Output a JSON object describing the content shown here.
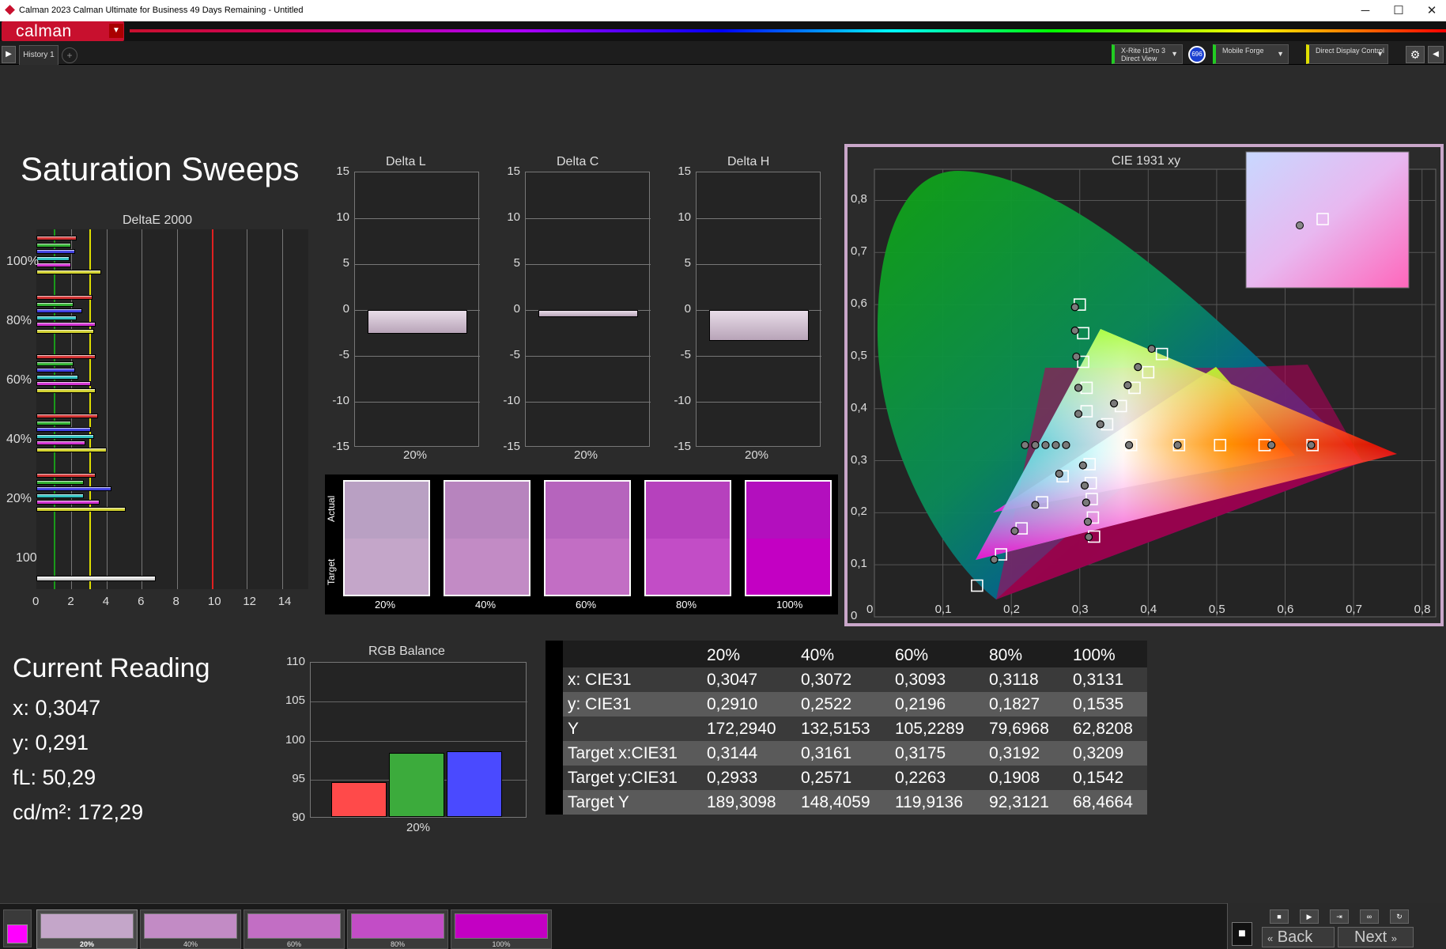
{
  "window": {
    "title": "Calman 2023 Calman Ultimate for Business 49 Days Remaining  - Untitled",
    "min": "─",
    "max": "☐",
    "close": "✕"
  },
  "app": {
    "logo": "calman",
    "history_tab": "History 1",
    "add_tab": "+"
  },
  "devices": [
    {
      "label1": "X-Rite i1Pro 3",
      "label2": "Direct View",
      "color": "#22cc22"
    },
    {
      "badge": "696"
    },
    {
      "label1": "Mobile Forge",
      "label2": "",
      "color": "#22cc22"
    },
    {
      "label1": "Direct Display Control",
      "label2": "",
      "color": "#e0e000"
    }
  ],
  "page": {
    "title": "Saturation Sweeps"
  },
  "deltae": {
    "title": "DeltaE 2000",
    "x_ticks": [
      "0",
      "2",
      "4",
      "6",
      "8",
      "10",
      "12",
      "14"
    ],
    "row_labels": [
      "100%",
      "80%",
      "60%",
      "40%",
      "20%",
      "100"
    ]
  },
  "delta_charts": [
    {
      "title": "Delta L",
      "value": -2.6,
      "xlabel": "20%"
    },
    {
      "title": "Delta C",
      "value": -0.8,
      "xlabel": "20%"
    },
    {
      "title": "Delta H",
      "value": -3.4,
      "xlabel": "20%"
    }
  ],
  "delta_ticks": [
    "15",
    "10",
    "5",
    "0",
    "-5",
    "-10",
    "-15"
  ],
  "swatches": {
    "actual_label": "Actual",
    "target_label": "Target",
    "items": [
      {
        "label": "20%",
        "actual": "#b9a0c3",
        "target": "#c4a6c9"
      },
      {
        "label": "40%",
        "actual": "#b784be",
        "target": "#c28bc5"
      },
      {
        "label": "60%",
        "actual": "#b664bd",
        "target": "#c26ec4"
      },
      {
        "label": "80%",
        "actual": "#b641bd",
        "target": "#c24dc6"
      },
      {
        "label": "100%",
        "actual": "#b30fbe",
        "target": "#c300c3"
      }
    ]
  },
  "cie": {
    "title": "CIE 1931 xy",
    "x_ticks": [
      "0",
      "0,1",
      "0,2",
      "0,3",
      "0,4",
      "0,5",
      "0,6",
      "0,7",
      "0,8"
    ],
    "y_ticks": [
      "0,8",
      "0,7",
      "0,6",
      "0,5",
      "0,4",
      "0,3",
      "0,2",
      "0,1",
      "0"
    ]
  },
  "reading": {
    "title": "Current Reading",
    "x": "x: 0,3047",
    "y": "y: 0,291",
    "fl": "fL: 50,29",
    "cd": "cd/m²: 172,29"
  },
  "rgb": {
    "title": "RGB Balance",
    "y_ticks": [
      "110",
      "105",
      "100",
      "95",
      "90"
    ],
    "xlabel": "20%",
    "values": {
      "r": 94.5,
      "g": 98.2,
      "b": 98.4
    }
  },
  "table": {
    "headers": [
      "",
      "20%",
      "40%",
      "60%",
      "80%",
      "100%"
    ],
    "rows": [
      [
        "x: CIE31",
        "0,3047",
        "0,3072",
        "0,3093",
        "0,3118",
        "0,3131"
      ],
      [
        "y: CIE31",
        "0,2910",
        "0,2522",
        "0,2196",
        "0,1827",
        "0,1535"
      ],
      [
        "Y",
        "172,2940",
        "132,5153",
        "105,2289",
        "79,6968",
        "62,8208"
      ],
      [
        "Target x:CIE31",
        "0,3144",
        "0,3161",
        "0,3175",
        "0,3192",
        "0,3209"
      ],
      [
        "Target y:CIE31",
        "0,2933",
        "0,2571",
        "0,2263",
        "0,1908",
        "0,1542"
      ],
      [
        "Target Y",
        "189,3098",
        "148,4059",
        "119,9136",
        "92,3121",
        "68,4664"
      ]
    ]
  },
  "bottom_tabs": [
    {
      "label": "20%",
      "color": "#c4a6c9"
    },
    {
      "label": "40%",
      "color": "#c28bc5"
    },
    {
      "label": "60%",
      "color": "#c26ec4"
    },
    {
      "label": "80%",
      "color": "#c24dc6"
    },
    {
      "label": "100%",
      "color": "#c300c3"
    }
  ],
  "nav": {
    "back": "Back",
    "next": "Next"
  }
}
